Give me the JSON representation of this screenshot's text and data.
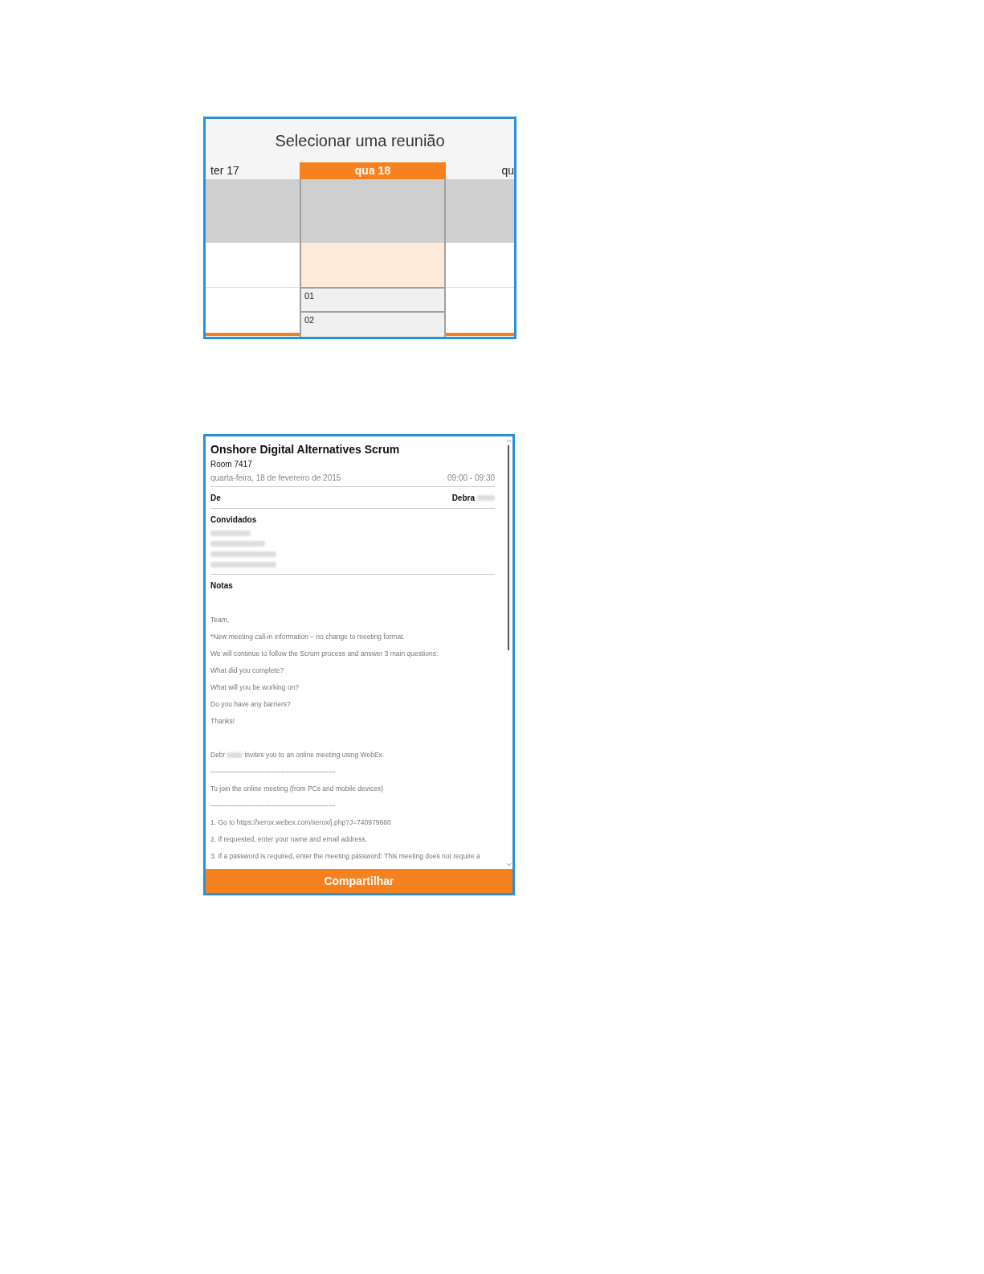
{
  "day_picker": {
    "title": "Selecionar uma reunião",
    "days": [
      {
        "label": "ter 17",
        "selected": false
      },
      {
        "label": "qua 18",
        "selected": true
      },
      {
        "label": "qu",
        "selected": false
      }
    ],
    "slots": [
      "01",
      "02"
    ]
  },
  "meeting": {
    "title": "Onshore Digital Alternatives Scrum",
    "room": "Room 7417",
    "date": "quarta-feira, 18 de fevereiro de 2015",
    "time": "09:00 - 09:30",
    "from_label": "De",
    "from_name": "Debra",
    "invitees_label": "Convidados",
    "notes_label": "Notas",
    "notes": [
      {
        "kind": "text",
        "text": "Team,"
      },
      {
        "kind": "text",
        "text": "*New meeting call-in information – no change to meeting format."
      },
      {
        "kind": "text",
        "text": "We will continue to follow the Scrum process and answer 3 main questions:"
      },
      {
        "kind": "text",
        "text": "What did you complete?"
      },
      {
        "kind": "text",
        "text": "What will you be working on?"
      },
      {
        "kind": "text",
        "text": "Do you have any barriers?"
      },
      {
        "kind": "text",
        "text": "Thanks!"
      },
      {
        "kind": "gap"
      },
      {
        "kind": "redacted",
        "before": "Debr",
        "after": "invites you to an online meeting using WebEx."
      },
      {
        "kind": "text",
        "text": "-------------------------------------------------------"
      },
      {
        "kind": "text",
        "text": "To join the online meeting (from PCs and mobile devices)"
      },
      {
        "kind": "text",
        "text": "-------------------------------------------------------"
      },
      {
        "kind": "text",
        "text": "1. Go to https://xerox.webex.com/xerox/j.php?J=740979660"
      },
      {
        "kind": "text",
        "text": "2. If requested, enter your name and email address."
      },
      {
        "kind": "text",
        "text": "3. If a password is required, enter the meeting password: This meeting does not require a"
      }
    ],
    "share_button": "Compartilhar"
  }
}
